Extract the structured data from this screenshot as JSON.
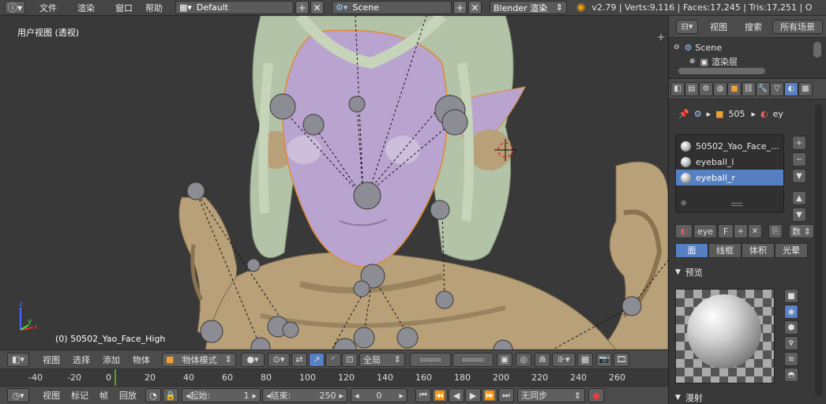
{
  "topbar": {
    "menus": [
      "文件",
      "渲染",
      "窗口",
      "帮助"
    ],
    "layout_name": "Default",
    "scene_name": "Scene",
    "render_engine": "Blender 渲染",
    "stats": "v2.79 | Verts:9,116 | Faces:17,245 | Tris:17,251 | Objec"
  },
  "viewport": {
    "view_label": "用户视图 (透视)",
    "object_label": "(0) 50502_Yao_Face_High"
  },
  "view_header": {
    "menus": [
      "视图",
      "选择",
      "添加",
      "物体"
    ],
    "mode": "物体模式",
    "pivot": "全局"
  },
  "timeline": {
    "ruler": [
      "-40",
      "-20",
      "0",
      "20",
      "40",
      "60",
      "80",
      "100",
      "120",
      "140",
      "160",
      "180",
      "200",
      "220",
      "240",
      "260"
    ],
    "menus": [
      "视图",
      "标记",
      "帧",
      "回放"
    ],
    "start_label": "起始:",
    "start_value": "1",
    "end_label": "结束:",
    "end_value": "250",
    "current_frame": "0",
    "sync": "无同步"
  },
  "outliner": {
    "menus": [
      "视图",
      "搜索"
    ],
    "filter": "所有场景",
    "items": [
      "Scene",
      "渲染层"
    ]
  },
  "properties": {
    "breadcrumb": [
      "505",
      "ey"
    ],
    "materials": [
      "50502_Yao_Face_...",
      "eyeball_l",
      "eyeball_r"
    ],
    "selected_material_index": 2,
    "material_name": "eye",
    "fake_user": "F",
    "data_dropdown": "数",
    "tabs": [
      "面",
      "线框",
      "体积",
      "光晕"
    ],
    "active_tab_index": 0,
    "preview_label": "预览",
    "diffuse_label": "漫射"
  },
  "colors": {
    "accent": "#5680c2",
    "skin": "#b9a3cf",
    "hair": "#b3c3a8",
    "cloth": "#b8a078"
  }
}
